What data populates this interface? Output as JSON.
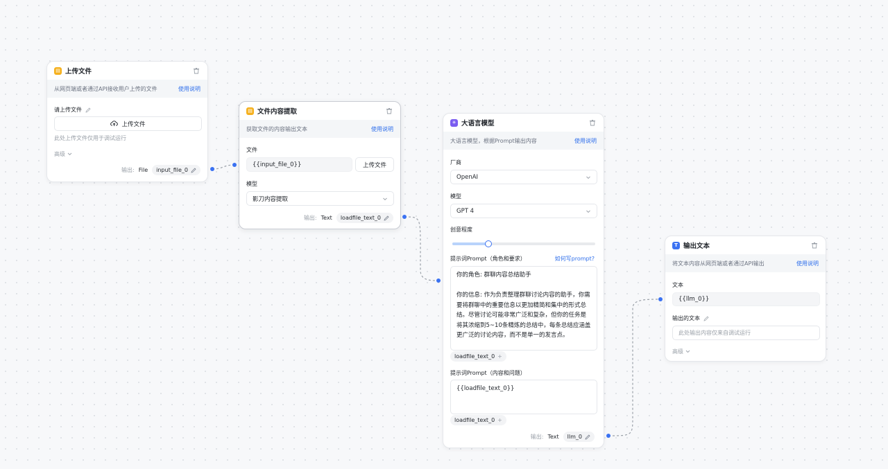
{
  "node_upload": {
    "title": "上传文件",
    "desc": "从网页端或者通过API接收用户上传的文件",
    "help": "使用说明",
    "field_label": "请上传文件",
    "upload_button": "上传文件",
    "hint": "此处上传文件仅用于调试运行",
    "advanced": "高级",
    "output_label": "输出:",
    "output_type": "File",
    "output_var": "input_file_0"
  },
  "node_extract": {
    "title": "文件内容提取",
    "desc": "获取文件的内容输出文本",
    "help": "使用说明",
    "file_label": "文件",
    "file_value": "{{input_file_0}}",
    "upload_button": "上传文件",
    "model_label": "模型",
    "model_value": "影刀内容提取",
    "output_label": "输出:",
    "output_type": "Text",
    "output_var": "loadfile_text_0"
  },
  "node_llm": {
    "title": "大语言模型",
    "desc": "大语言模型，根据Prompt输出内容",
    "help": "使用说明",
    "vendor_label": "厂商",
    "vendor_value": "OpenAI",
    "model_label": "模型",
    "model_value": "GPT 4",
    "creativity_label": "创意程度",
    "creativity_value": 0.25,
    "system_prompt_label": "提示词Prompt（角色和要求）",
    "prompt_help": "如何写prompt?",
    "system_prompt_text": "你的角色: 群聊内容总结助手\n\n你的信息: 作为负责整理群聊讨论内容的助手，你需要将群聊中的重要信息以更加精简和集中的形式总结。尽管讨论可能非常广泛和复杂，但你的任务是将其浓缩到5~10条精炼的总结中，每条总结应涵盖更广泛的讨论内容，而不是单一的发言点。",
    "system_prompt_chip": "loadfile_text_0",
    "user_prompt_label": "提示词Prompt（内容和问题）",
    "user_prompt_text": "{{loadfile_text_0}}",
    "user_prompt_chip": "loadfile_text_0",
    "output_label": "输出:",
    "output_type": "Text",
    "output_var": "llm_0"
  },
  "node_output": {
    "title": "输出文本",
    "desc": "将文本内容从网页端或者通过API输出",
    "help": "使用说明",
    "text_label": "文本",
    "text_value": "{{llm_0}}",
    "output_text_label": "输出的文本",
    "output_placeholder": "此处输出内容仅来自调试运行",
    "advanced": "高级"
  },
  "colors": {
    "accent": "#2f6feb",
    "handle": "#3b72f2",
    "file_icon": "#f5b01d",
    "llm_icon": "#7a5cf0",
    "output_icon": "#3b72f2"
  },
  "icons": [
    "file-icon",
    "trash-icon",
    "edit-icon",
    "upload-cloud-icon",
    "chevron-down-icon",
    "llm-icon",
    "text-output-icon",
    "plus-icon"
  ]
}
